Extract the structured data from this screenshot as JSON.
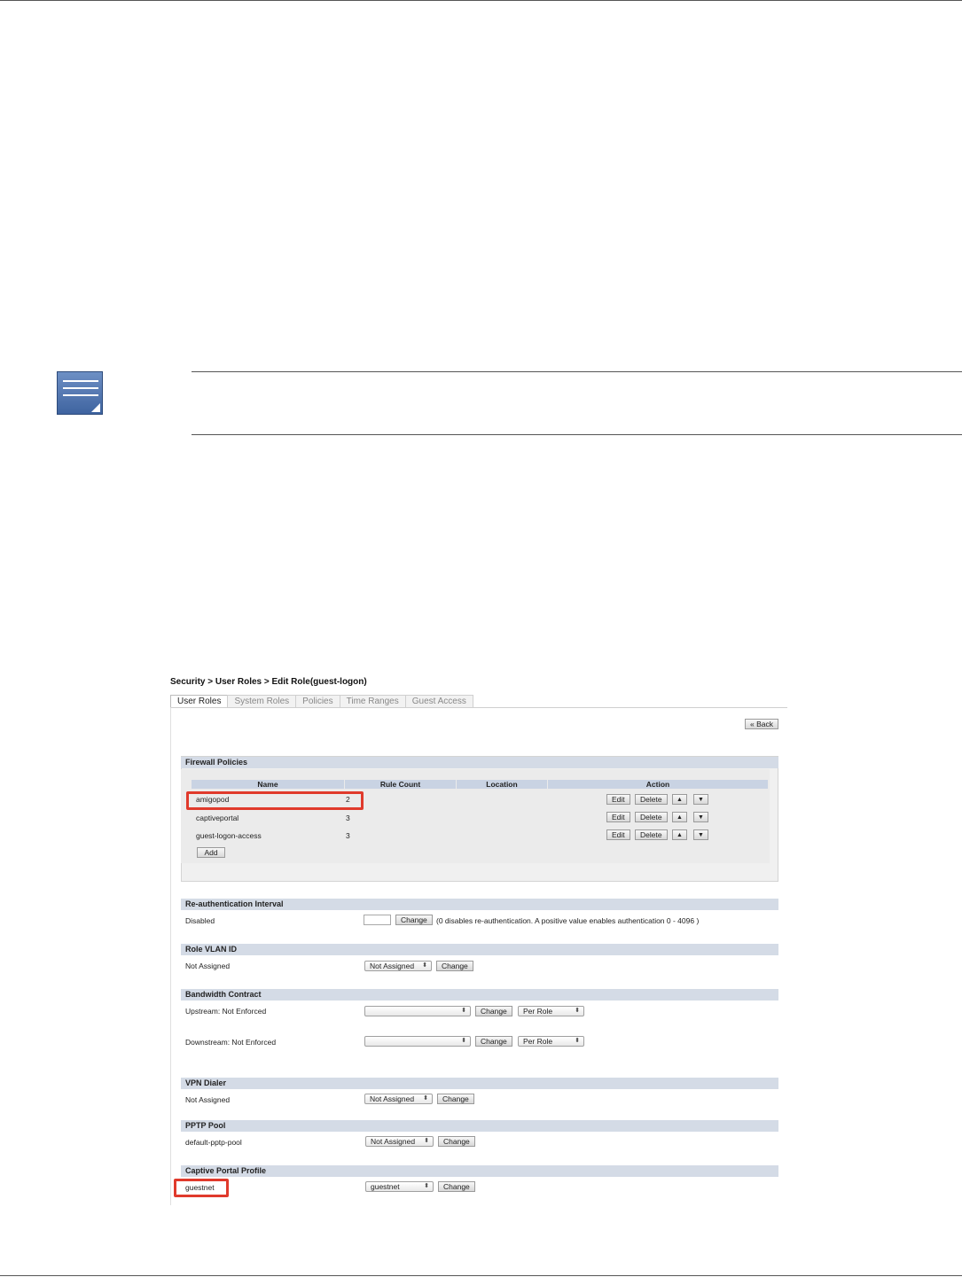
{
  "breadcrumb": "Security > User Roles > Edit Role(guest-logon)",
  "tabs": [
    "User Roles",
    "System Roles",
    "Policies",
    "Time Ranges",
    "Guest Access"
  ],
  "back_label": "« Back",
  "firewall": {
    "title": "Firewall Policies",
    "columns": [
      "Name",
      "Rule Count",
      "Location",
      "Action"
    ],
    "rows": [
      {
        "name": "amigopod",
        "count": "2"
      },
      {
        "name": "captiveportal",
        "count": "3"
      },
      {
        "name": "guest-logon-access",
        "count": "3"
      }
    ],
    "edit_label": "Edit",
    "delete_label": "Delete",
    "up_label": "▲",
    "down_label": "▼",
    "add_label": "Add"
  },
  "reauth": {
    "title": "Re-authentication Interval",
    "label": "Disabled",
    "change_label": "Change",
    "hint": "(0 disables re-authentication. A positive value enables authentication 0 - 4096 )"
  },
  "vlan": {
    "title": "Role VLAN ID",
    "label": "Not Assigned",
    "select_value": "Not Assigned",
    "change_label": "Change"
  },
  "bandwidth": {
    "title": "Bandwidth Contract",
    "upstream_label": "Upstream: Not Enforced",
    "downstream_label": "Downstream: Not Enforced",
    "change_label": "Change",
    "per_role": "Per Role"
  },
  "vpn": {
    "title": "VPN Dialer",
    "label": "Not Assigned",
    "select_value": "Not Assigned",
    "change_label": "Change"
  },
  "pptp": {
    "title": "PPTP Pool",
    "label": "default-pptp-pool",
    "select_value": "Not Assigned",
    "change_label": "Change"
  },
  "captive": {
    "title": "Captive Portal Profile",
    "label": "guestnet",
    "select_value": "guestnet",
    "change_label": "Change"
  },
  "colors": {
    "highlight": "#e03a2c",
    "section_header": "#d4dbe6",
    "note_icon": "#4f72ad"
  }
}
